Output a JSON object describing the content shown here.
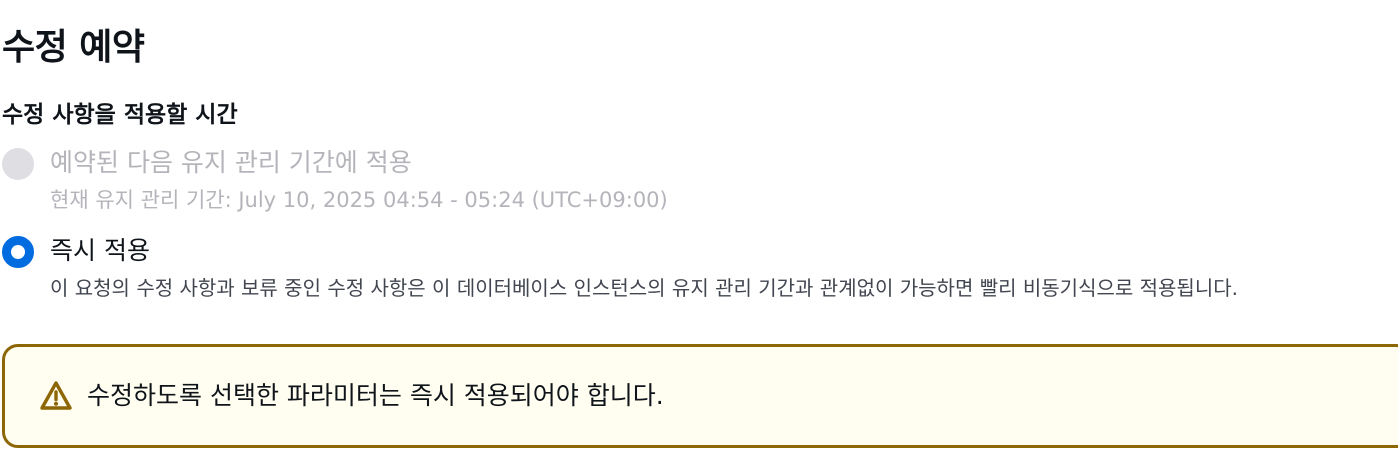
{
  "section": {
    "title": "수정 예약"
  },
  "apply_time": {
    "label": "수정 사항을 적용할 시간",
    "options": [
      {
        "label": "예약된 다음 유지 관리 기간에 적용",
        "description": "현재 유지 관리 기간: July 10, 2025 04:54 - 05:24 (UTC+09:00)",
        "selected": false,
        "disabled": true
      },
      {
        "label": "즉시 적용",
        "description": "이 요청의 수정 사항과 보류 중인 수정 사항은 이 데이터베이스 인스턴스의 유지 관리 기간과 관계없이 가능하면 빨리 비동기식으로 적용됩니다.",
        "selected": true,
        "disabled": false
      }
    ]
  },
  "alert": {
    "type": "warning",
    "icon": "warning-icon",
    "message": "수정하도록 선택한 파라미터는 즉시 적용되어야 합니다."
  },
  "colors": {
    "accent": "#006ce0",
    "warning_border": "#8d6605",
    "warning_background": "#fffef0",
    "disabled_text": "#b4b4bb"
  }
}
